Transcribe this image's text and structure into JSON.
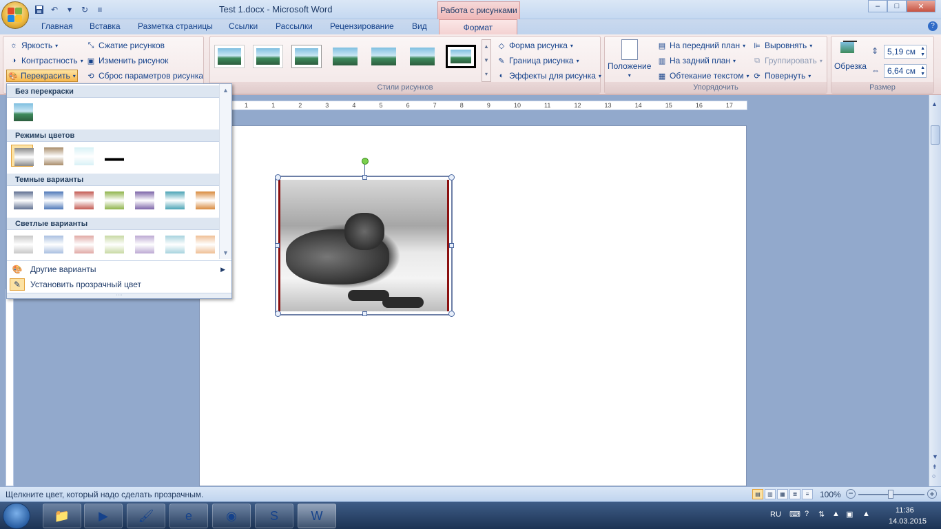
{
  "window": {
    "title": "Test 1.docx - Microsoft Word",
    "context_tab_title": "Работа с рисунками",
    "controls": {
      "minimize": "–",
      "maximize": "□",
      "close": "✕"
    }
  },
  "quick_access": {
    "save_icon": "save-icon",
    "undo_icon": "undo-icon",
    "redo_icon": "redo-icon",
    "more": "▾"
  },
  "tabs": [
    {
      "label": "Главная"
    },
    {
      "label": "Вставка"
    },
    {
      "label": "Разметка страницы"
    },
    {
      "label": "Ссылки"
    },
    {
      "label": "Рассылки"
    },
    {
      "label": "Рецензирование"
    },
    {
      "label": "Вид"
    },
    {
      "label": "Формат"
    }
  ],
  "ribbon": {
    "adjust": {
      "brightness": "Яркость",
      "contrast": "Контрастность",
      "recolor": "Перекрасить",
      "compress": "Сжатие рисунков",
      "change": "Изменить рисунок",
      "reset": "Сброс параметров рисунка"
    },
    "styles": {
      "label": "Стили рисунков",
      "shape": "Форма рисунка",
      "border": "Граница рисунка",
      "effects": "Эффекты для рисунка"
    },
    "arrange": {
      "label": "Упорядочить",
      "position": "Положение",
      "bring_front": "На передний план",
      "send_back": "На задний план",
      "wrap": "Обтекание текстом",
      "align": "Выровнять",
      "group": "Группировать",
      "rotate": "Повернуть"
    },
    "size": {
      "label": "Размер",
      "crop": "Обрезка",
      "height": "5,19 см",
      "width": "6,64 см"
    }
  },
  "ruler": {
    "marks": [
      "1",
      "1",
      "2",
      "3",
      "4",
      "5",
      "6",
      "7",
      "8",
      "9",
      "10",
      "11",
      "12",
      "13",
      "14",
      "15",
      "16",
      "17"
    ]
  },
  "recolor_menu": {
    "no_recolor": "Без перекраски",
    "color_modes": "Режимы цветов",
    "dark_variants": "Темные варианты",
    "light_variants": "Светлые варианты",
    "more_variants": "Другие варианты",
    "set_transparent": "Установить прозрачный цвет",
    "mode_colors": [
      "#8a8a8a",
      "#a88c6a",
      "#d8f1f6",
      "#000000"
    ],
    "dark_colors": [
      "#5f6f91",
      "#4d77b8",
      "#c35a52",
      "#8fb34a",
      "#7c64a8",
      "#4aa3b5",
      "#d98b3e"
    ],
    "light_colors": [
      "#c8c8c8",
      "#a9bfe0",
      "#e0a9a5",
      "#c8d9a3",
      "#bca9d3",
      "#a7d3de",
      "#efbf95"
    ]
  },
  "statusbar": {
    "message": "Щелкните цвет, который надо сделать прозрачным.",
    "zoom": "100%",
    "zoom_level": 100
  },
  "taskbar": {
    "lang": "RU",
    "time": "11:36",
    "date": "14.03.2015"
  }
}
